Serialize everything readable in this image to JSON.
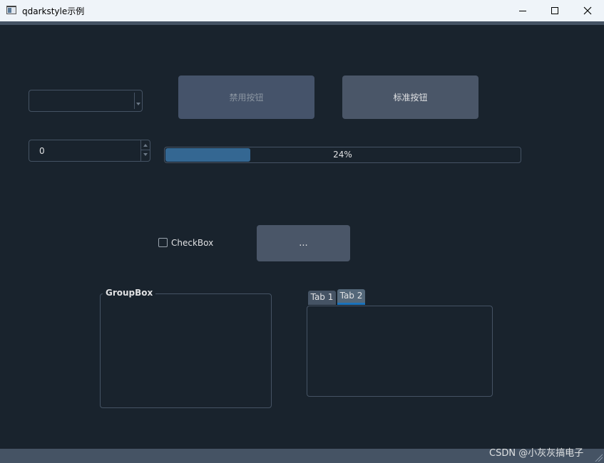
{
  "window": {
    "title": "qdarkstyle示例"
  },
  "controls": {
    "combo_value": "",
    "disabled_button_label": "禁用按钮",
    "standard_button_label": "标准按钮",
    "spin_value": "0",
    "progress_percent": 24,
    "progress_text": "24%",
    "checkbox_label": "CheckBox",
    "checkbox_checked": false,
    "dots_button_label": "...",
    "groupbox_title": "GroupBox",
    "tabs": [
      {
        "label": "Tab 1"
      },
      {
        "label": "Tab 2"
      }
    ],
    "active_tab": "Tab 2"
  },
  "colors": {
    "background": "#19232d",
    "button": "#455364",
    "progress_fill": "#346792",
    "tab_indicator": "#1a72bb"
  },
  "icons": {
    "window_icon": "app-window-icon",
    "minimize": "minimize-icon",
    "maximize": "maximize-icon",
    "close": "close-icon"
  },
  "watermark": "CSDN @小灰灰搞电子"
}
